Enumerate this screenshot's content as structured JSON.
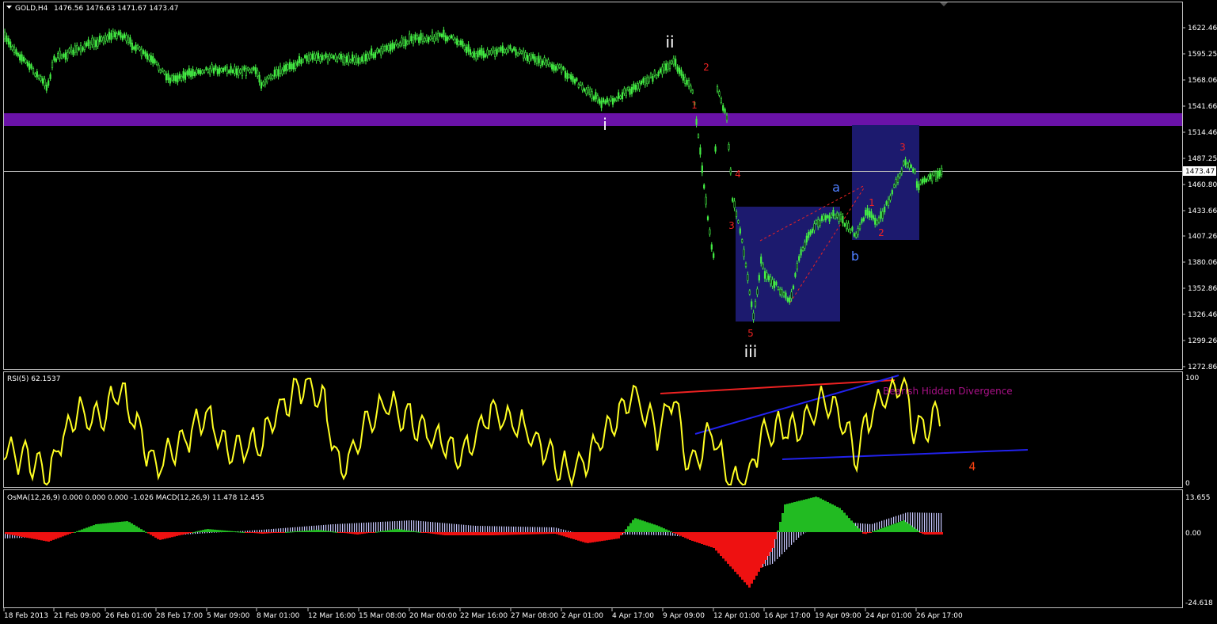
{
  "header": {
    "symbol": "GOLD,H4",
    "ohlc": "1476.56 1476.63 1471.67 1473.47",
    "menu_icon": "dropdown-triangle-icon"
  },
  "price_axis": {
    "labels": [
      "1622.46",
      "1595.25",
      "1568.06",
      "1541.66",
      "1514.46",
      "1487.25",
      "1460.80",
      "1433.66",
      "1407.26",
      "1380.06",
      "1352.86",
      "1326.46",
      "1299.26",
      "1272.86"
    ],
    "current": "1473.47"
  },
  "rsi": {
    "title": "RSI(5) 62.1537",
    "max_label": "100",
    "min_label": "0",
    "annotation": "Bearish Hidden Divergence"
  },
  "macd": {
    "title": "OsMA(12,26,9) 0.000 0.000 0.000 -1.026  MACD(12,26,9) 11.478 12.455",
    "labels": [
      "13.655",
      "0.00",
      "-24.618"
    ]
  },
  "time_axis": [
    "18 Feb 2013",
    "21 Feb 09:00",
    "26 Feb 01:00",
    "28 Feb 17:00",
    "5 Mar 09:00",
    "8 Mar 01:00",
    "12 Mar 16:00",
    "15 Mar 08:00",
    "20 Mar 00:00",
    "22 Mar 16:00",
    "27 Mar 08:00",
    "2 Apr 01:00",
    "4 Apr 17:00",
    "9 Apr 09:00",
    "12 Apr 01:00",
    "16 Apr 17:00",
    "19 Apr 09:00",
    "24 Apr 01:00",
    "26 Apr 17:00"
  ],
  "wave_labels": {
    "i": "i",
    "ii": "ii",
    "iii": "iii",
    "r1": "1",
    "r2": "2",
    "r3": "3",
    "r4": "4",
    "r5": "5",
    "a": "a",
    "b": "b",
    "s1": "1",
    "s2": "2",
    "s3": "3",
    "rsi4": "4"
  },
  "colors": {
    "price": "#44ee44",
    "rsi": "#ffff22",
    "resistance": "#6a12a8",
    "box": "#1c1a6e",
    "osma_up": "#22bb22",
    "osma_down": "#ee1111",
    "macd": "#c8c8ff"
  },
  "chart_data": {
    "type": "line",
    "title": "GOLD,H4",
    "x": [
      "18 Feb 2013",
      "21 Feb 09:00",
      "26 Feb 01:00",
      "28 Feb 17:00",
      "5 Mar 09:00",
      "8 Mar 01:00",
      "12 Mar 16:00",
      "15 Mar 08:00",
      "20 Mar 00:00",
      "22 Mar 16:00",
      "27 Mar 08:00",
      "2 Apr 01:00",
      "4 Apr 17:00",
      "9 Apr 09:00",
      "12 Apr 01:00",
      "16 Apr 17:00",
      "19 Apr 09:00",
      "24 Apr 01:00",
      "26 Apr 17:00"
    ],
    "series": [
      {
        "name": "GOLD,H4",
        "values": [
          1613,
          1590,
          1612,
          1585,
          1580,
          1578,
          1593,
          1590,
          1610,
          1608,
          1600,
          1580,
          1548,
          1578,
          1380,
          1370,
          1420,
          1432,
          1473
        ]
      }
    ],
    "ylim": [
      1272.86,
      1635
    ],
    "current_price": 1473.47,
    "resistance_band": [
      1517,
      1531
    ]
  }
}
